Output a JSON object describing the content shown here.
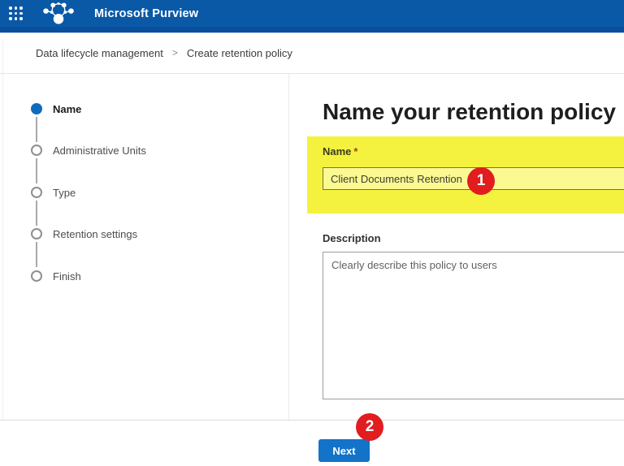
{
  "header": {
    "app_title": "Microsoft Purview",
    "app_launcher_icon": "waffle-grid",
    "logo_icon": "purview-network-logo"
  },
  "breadcrumb": {
    "items": [
      "Data lifecycle management",
      "Create retention policy"
    ],
    "separator": ">"
  },
  "wizard": {
    "steps": [
      {
        "label": "Name",
        "state": "active"
      },
      {
        "label": "Administrative Units",
        "state": "pending"
      },
      {
        "label": "Type",
        "state": "pending"
      },
      {
        "label": "Retention settings",
        "state": "pending"
      },
      {
        "label": "Finish",
        "state": "pending"
      }
    ]
  },
  "main": {
    "heading": "Name your retention policy",
    "name_field": {
      "label": "Name",
      "required_marker": "*",
      "value": "Client Documents Retention"
    },
    "description_field": {
      "label": "Description",
      "placeholder": "Clearly describe this policy to users"
    }
  },
  "footer": {
    "next_label": "Next"
  },
  "annotations": {
    "badges": [
      {
        "number": "1"
      },
      {
        "number": "2"
      }
    ]
  },
  "colors": {
    "header": "#0a59a7",
    "headerStrip": "#0a4f9c",
    "accent": "#0f6cbd",
    "button": "#1273c8",
    "highlight": "#f5f23f",
    "annotation": "#e11d20"
  }
}
